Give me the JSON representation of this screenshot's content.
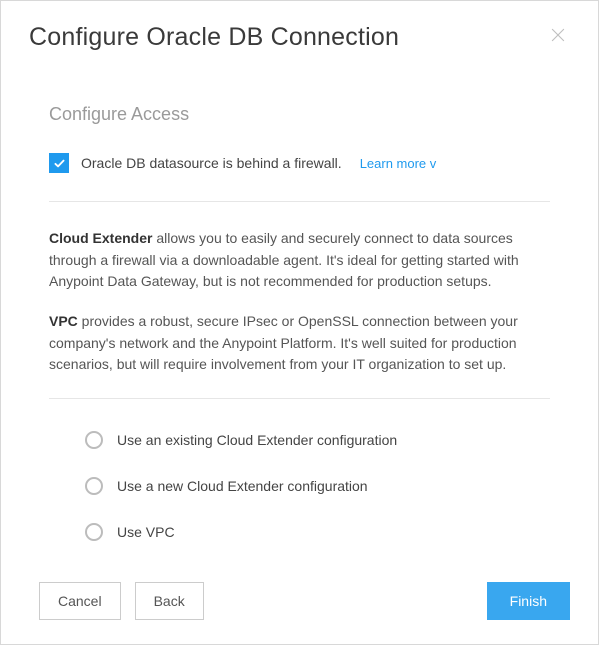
{
  "header": {
    "title": "Configure Oracle DB Connection"
  },
  "section_title": "Configure Access",
  "firewall": {
    "label": "Oracle DB datasource is behind a firewall.",
    "learn_more": "Learn more v",
    "checked": true
  },
  "info": {
    "cloud_extender_label": "Cloud Extender",
    "cloud_extender_text": " allows you to easily and securely connect to data sources through a firewall via a downloadable agent. It's ideal for getting started with Anypoint Data Gateway, but is not recommended for production setups.",
    "vpc_label": "VPC",
    "vpc_text": " provides a robust, secure IPsec or OpenSSL connection between your company's network and the Anypoint Platform. It's well suited for production scenarios, but will require involvement from your IT organization to set up."
  },
  "radios": [
    {
      "label": "Use an existing Cloud Extender configuration"
    },
    {
      "label": "Use a new Cloud Extender configuration"
    },
    {
      "label": "Use VPC"
    }
  ],
  "footer": {
    "cancel": "Cancel",
    "back": "Back",
    "finish": "Finish"
  }
}
